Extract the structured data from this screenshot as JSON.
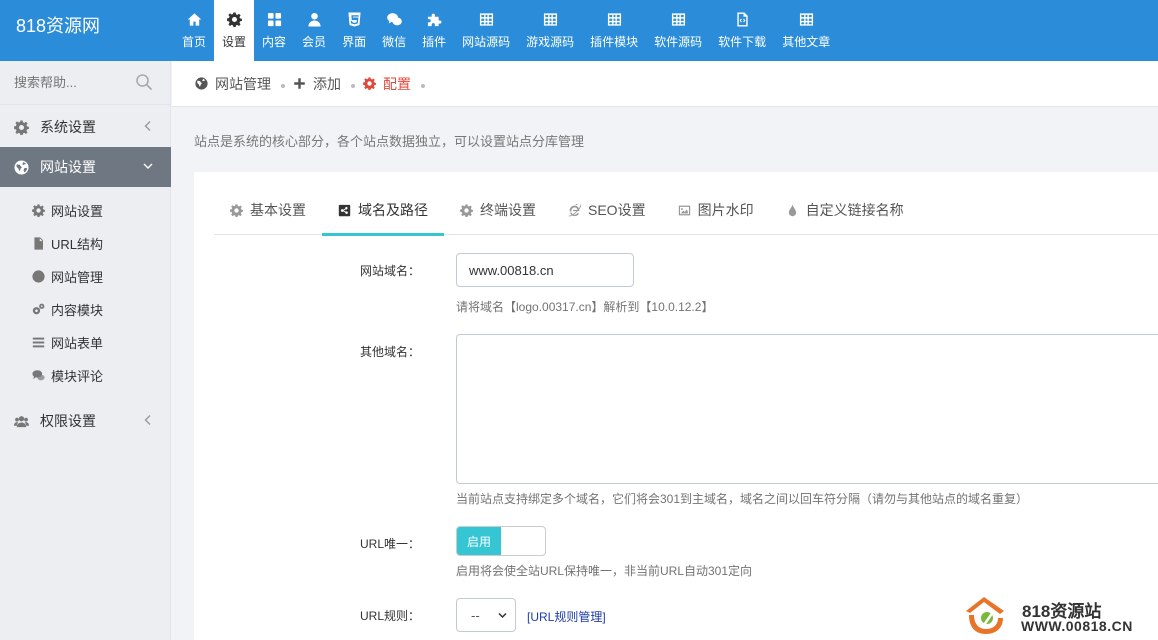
{
  "app": {
    "logo": "818资源网"
  },
  "topnav": [
    {
      "label": "首页",
      "icon": "home-icon"
    },
    {
      "label": "设置",
      "icon": "gear-icon",
      "active": true
    },
    {
      "label": "内容",
      "icon": "grid-icon"
    },
    {
      "label": "会员",
      "icon": "user-icon"
    },
    {
      "label": "界面",
      "icon": "html5-icon"
    },
    {
      "label": "微信",
      "icon": "wechat-icon"
    },
    {
      "label": "插件",
      "icon": "puzzle-icon"
    },
    {
      "label": "网站源码",
      "icon": "table-icon"
    },
    {
      "label": "游戏源码",
      "icon": "table-icon"
    },
    {
      "label": "插件模块",
      "icon": "table-icon"
    },
    {
      "label": "软件源码",
      "icon": "table-icon"
    },
    {
      "label": "软件下载",
      "icon": "file-code-icon"
    },
    {
      "label": "其他文章",
      "icon": "table-icon"
    }
  ],
  "sidebar": {
    "search_placeholder": "搜索帮助...",
    "groups": [
      {
        "label": "系统设置",
        "icon": "gear-icon",
        "open": false
      },
      {
        "label": "网站设置",
        "icon": "globe-icon",
        "open": true
      },
      {
        "label": "权限设置",
        "icon": "users-icon",
        "open": false
      }
    ],
    "items": [
      {
        "label": "网站设置",
        "icon": "gear-icon"
      },
      {
        "label": "URL结构",
        "icon": "file-icon"
      },
      {
        "label": "网站管理",
        "icon": "globe-icon"
      },
      {
        "label": "内容模块",
        "icon": "gears-icon"
      },
      {
        "label": "网站表单",
        "icon": "list-icon"
      },
      {
        "label": "模块评论",
        "icon": "comments-icon"
      }
    ]
  },
  "breadcrumb": [
    {
      "label": "网站管理",
      "icon": "globe-icon"
    },
    {
      "label": "添加",
      "icon": "plus-icon"
    },
    {
      "label": "配置",
      "icon": "gear-icon",
      "active": true
    }
  ],
  "notice": "站点是系统的核心部分，各个站点数据独立，可以设置站点分库管理",
  "tabs": [
    {
      "label": "基本设置",
      "icon": "gear-icon"
    },
    {
      "label": "域名及路径",
      "icon": "share-icon",
      "active": true
    },
    {
      "label": "终端设置",
      "icon": "gear-icon"
    },
    {
      "label": "SEO设置",
      "icon": "ie-icon"
    },
    {
      "label": "图片水印",
      "icon": "image-icon"
    },
    {
      "label": "自定义链接名称",
      "icon": "drop-icon"
    }
  ],
  "form": {
    "domain_label": "网站域名：",
    "domain_value": "www.00818.cn",
    "domain_help": "请将域名【logo.00317.cn】解析到【10.0.12.2】",
    "other_label": "其他域名：",
    "other_help": "当前站点支持绑定多个域名，它们将会301到主域名，域名之间以回车符分隔（请勿与其他站点的域名重复）",
    "url_unique_label": "URL唯一：",
    "switch_on_label": "启用",
    "url_unique_help": "启用将会使全站URL保持唯一，非当前URL自动301定向",
    "url_rule_label": "URL规则：",
    "url_rule_value": "--",
    "url_rule_link": "[URL规则管理]"
  },
  "watermark": {
    "title": "818资源站",
    "url": "WWW.00818.CN"
  }
}
